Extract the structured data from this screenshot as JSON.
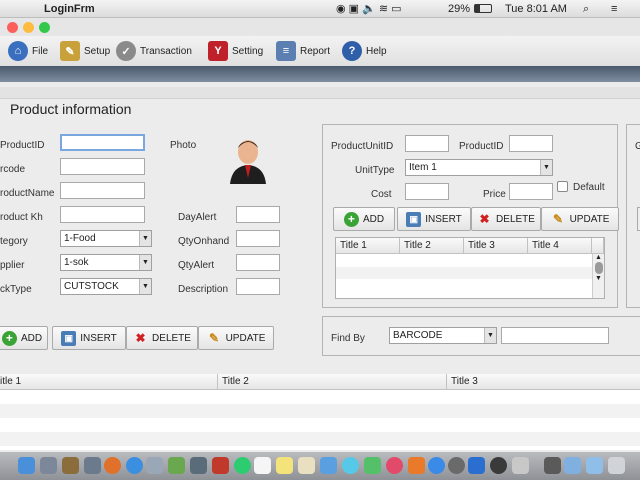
{
  "menubar": {
    "app": "LoginFrm",
    "battery": "29%",
    "clock": "Tue 8:01 AM"
  },
  "toolbar": {
    "items": [
      {
        "label": "File",
        "icon": "home-icon",
        "color": "#3a6fbf"
      },
      {
        "label": "Setup",
        "icon": "wand-icon",
        "color": "#c9a13a"
      },
      {
        "label": "Transaction",
        "icon": "gear-check-icon",
        "color": "#8a8a8a"
      },
      {
        "label": "Setting",
        "icon": "setting-icon",
        "color": "#c0202a"
      },
      {
        "label": "Report",
        "icon": "report-icon",
        "color": "#5a7fb0"
      },
      {
        "label": "Help",
        "icon": "help-icon",
        "color": "#2e5fa8"
      }
    ]
  },
  "product": {
    "heading": "Product information",
    "labels": {
      "id": "ProductID",
      "barcode": "rcode",
      "name": "roductName",
      "kh": "roduct Kh",
      "category": "tegory",
      "supplier": "pplier",
      "stocktype": "ckType",
      "photo": "Photo",
      "dayalert": "DayAlert",
      "qtyonhand": "QtyOnhand",
      "qtyalert": "QtyAlert",
      "description": "Description"
    },
    "values": {
      "id": "",
      "barcode": "",
      "name": "",
      "kh": "",
      "category": "1-Food",
      "supplier": "1-sok",
      "stocktype": "CUTSTOCK",
      "dayalert": "",
      "qtyonhand": "",
      "qtyalert": "",
      "description": ""
    },
    "buttons": {
      "add": "ADD",
      "insert": "INSERT",
      "delete": "DELETE",
      "update": "UPDATE"
    },
    "table": {
      "headers": [
        "itle 1",
        "Title 2",
        "Title 3"
      ]
    }
  },
  "unit": {
    "labels": {
      "unitid": "ProductUnitID",
      "productid": "ProductID",
      "unittype": "UnitType",
      "cost": "Cost",
      "price": "Price",
      "default": "Default"
    },
    "values": {
      "unitid": "",
      "productid": "",
      "unittype": "Item 1",
      "cost": "",
      "price": "",
      "default": false
    },
    "buttons": {
      "add": "ADD",
      "insert": "INSERT",
      "delete": "DELETE",
      "update": "UPDATE"
    },
    "table": {
      "headers": [
        "Title 1",
        "Title 2",
        "Title 3",
        "Title 4"
      ]
    }
  },
  "find": {
    "label": "Find By",
    "option": "BARCODE",
    "value": ""
  },
  "right_edge": {
    "label": "G"
  }
}
